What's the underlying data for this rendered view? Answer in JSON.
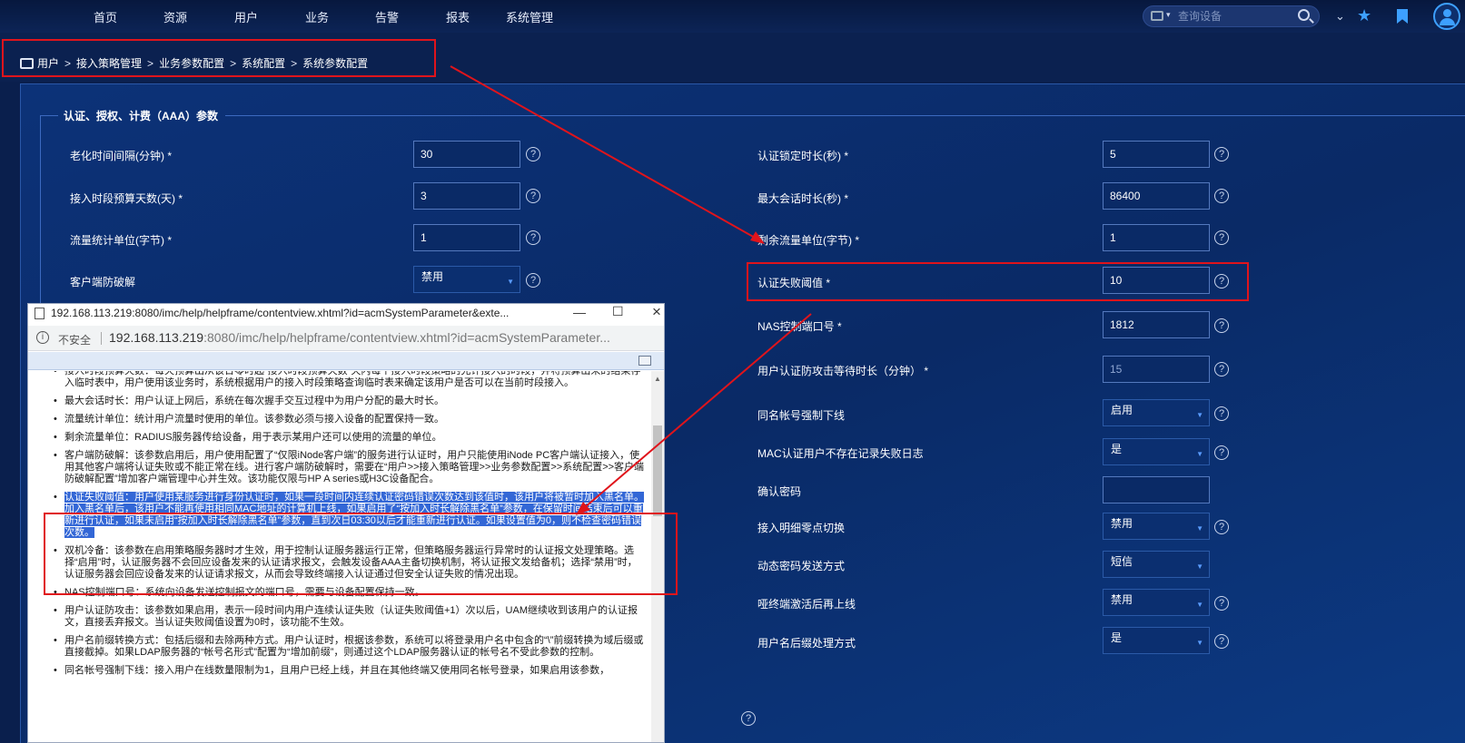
{
  "topnav": {
    "items": [
      "首页",
      "资源",
      "用户",
      "业务",
      "告警",
      "报表",
      "系统管理"
    ],
    "search_placeholder": "查询设备",
    "dropdown_glyph": "▾"
  },
  "breadcrumb": [
    "用户",
    "接入策略管理",
    "业务参数配置",
    "系统配置",
    "系统参数配置"
  ],
  "section_title": "认证、授权、计费（AAA）参数",
  "left_fields": [
    {
      "label": "老化时间间隔(分钟) *",
      "value": "30"
    },
    {
      "label": "接入时段预算天数(天) *",
      "value": "3"
    },
    {
      "label": "流量统计单位(字节) *",
      "value": "1"
    },
    {
      "label": "客户端防破解",
      "value": "禁用"
    }
  ],
  "right_fields": [
    {
      "label": "认证锁定时长(秒) *",
      "value": "5"
    },
    {
      "label": "最大会话时长(秒) *",
      "value": "86400"
    },
    {
      "label": "剩余流量单位(字节) *",
      "value": "1"
    },
    {
      "label": "认证失败阈值 *",
      "value": "10"
    },
    {
      "label": "NAS控制端口号 *",
      "value": "1812"
    },
    {
      "label": "用户认证防攻击等待时长（分钟） *",
      "value": "15"
    },
    {
      "label": "同名帐号强制下线",
      "value": "启用"
    },
    {
      "label": "MAC认证用户不存在记录失败日志",
      "value": "是"
    },
    {
      "label": "确认密码",
      "value": ""
    },
    {
      "label": "接入明细零点切换",
      "value": "禁用"
    },
    {
      "label": "动态密码发送方式",
      "value": "短信"
    },
    {
      "label": "哑终端激活后再上线",
      "value": "禁用"
    },
    {
      "label": "用户名后缀处理方式",
      "value": "是"
    }
  ],
  "help_glyph": "?",
  "popup": {
    "title": "192.168.113.219:8080/imc/help/helpframe/contentview.xhtml?id=acmSystemParameter&exte...",
    "not_secure": "不安全",
    "url_host": "192.168.113.219",
    "url_rest": ":8080/imc/help/helpframe/contentview.xhtml?id=acmSystemParameter...",
    "items": [
      "接入时段预算天数：每天预算出从该日零时起“接入时段预算天数”天内每个接入时段策略的允许接入的时段，并将预算出来的结果存入临时表中，用户使用该业务时，系统根据用户的接入时段策略查询临时表来确定该用户是否可以在当前时段接入。",
      "最大会话时长：用户认证上网后，系统在每次握手交互过程中为用户分配的最大时长。",
      "流量统计单位：统计用户流量时使用的单位。该参数必须与接入设备的配置保持一致。",
      "剩余流量单位：RADIUS服务器传给设备，用于表示某用户还可以使用的流量的单位。",
      "客户端防破解：该参数启用后，用户使用配置了“仅限iNode客户端”的服务进行认证时，用户只能使用iNode PC客户端认证接入，使用其他客户端将认证失败或不能正常在线。进行客户端防破解时，需要在“用户>>接入策略管理>>业务参数配置>>系统配置>>客户端防破解配置”增加客户端管理中心并生效。该功能仅限与HP A series或H3C设备配合。",
      "认证失败阈值：用户使用某服务进行身份认证时，如果一段时间内连续认证密码错误次数达到该值时，该用户将被暂时加入黑名单。加入黑名单后，该用户不能再使用相同MAC地址的计算机上线，如果启用了“按加入时长解除黑名单”参数，在保留时间结束后可以重新进行认证，如果未启用“按加入时长解除黑名单”参数，直到次日03:30以后才能重新进行认证。如果设置值为0，则不检查密码错误次数。",
      "双机冷备：该参数在启用策略服务器时才生效，用于控制认证服务器运行正常，但策略服务器运行异常时的认证报文处理策略。选择“启用”时，认证服务器不会回应设备发来的认证请求报文，会触发设备AAA主备切换机制，将认证报文发给备机；选择“禁用”时，认证服务器会回应设备发来的认证请求报文，从而会导致终端接入认证通过但安全认证失败的情况出现。",
      "NAS控制端口号：系统向设备发送控制报文的端口号，需要与设备配置保持一致。",
      "用户认证防攻击：该参数如果启用，表示一段时间内用户连续认证失败（认证失败阈值+1）次以后，UAM继续收到该用户的认证报文，直接丢弃报文。当认证失败阈值设置为0时，该功能不生效。",
      "用户名前缀转换方式：包括后缀和去除两种方式。用户认证时，根据该参数，系统可以将登录用户名中包含的“\\”前缀转换为域后缀或直接截掉。如果LDAP服务器的“帐号名形式”配置为“增加前缀”，则通过这个LDAP服务器认证的帐号名不受此参数的控制。",
      "同名帐号强制下线：接入用户在线数量限制为1，且用户已经上线，并且在其他终端又使用同名帐号登录，如果启用该参数，"
    ]
  },
  "colors": {
    "highlight_border": "#e0141b",
    "selection": "#3367d6",
    "accent": "#3da0ff"
  }
}
